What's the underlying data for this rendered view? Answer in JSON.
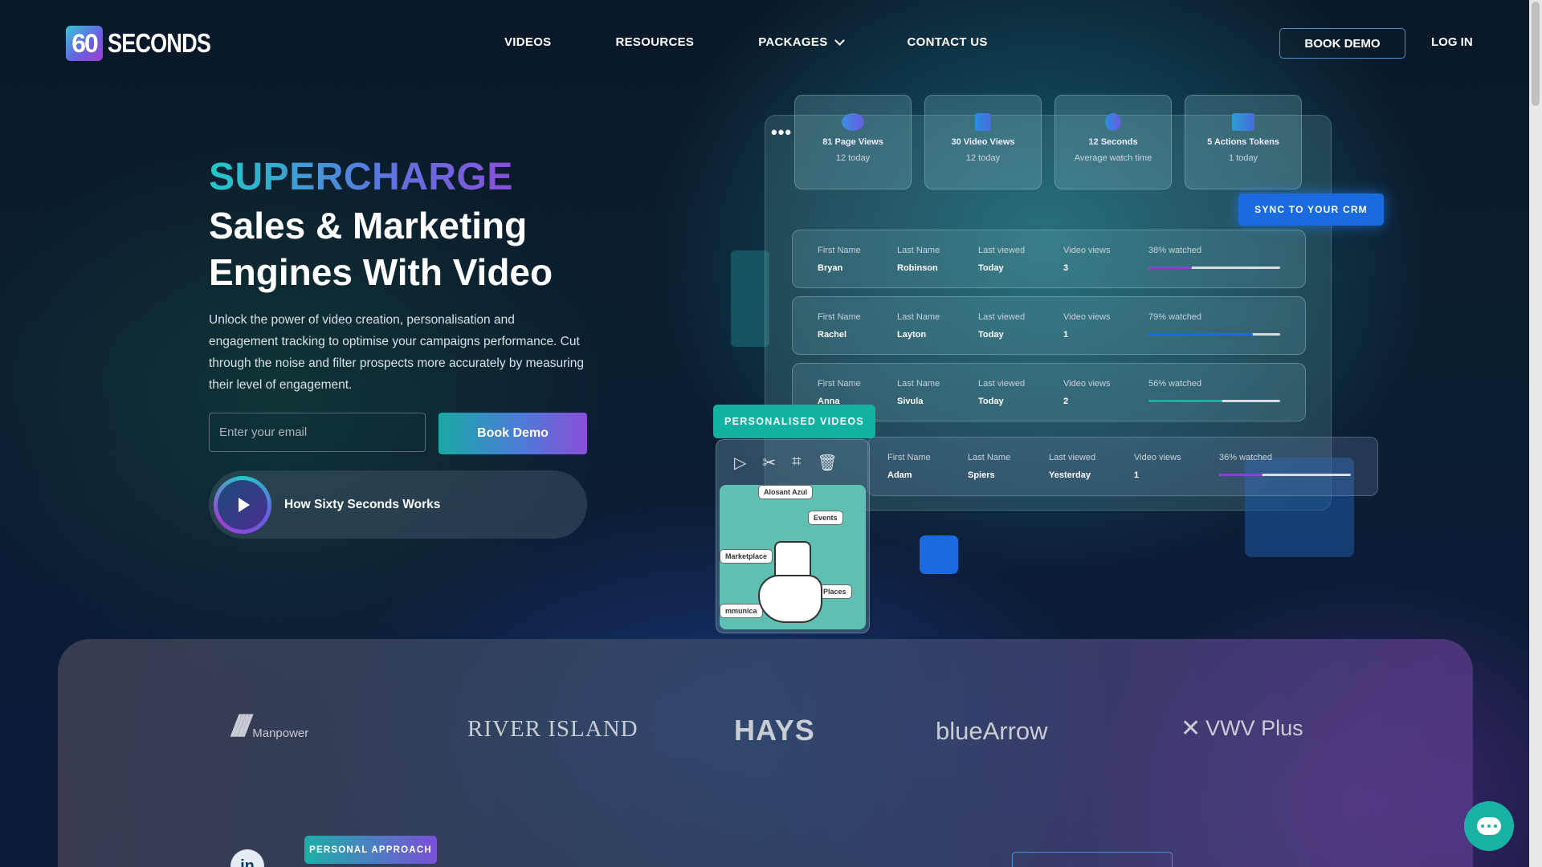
{
  "brand": {
    "logo_number": "60",
    "logo_word": "SECONDS"
  },
  "nav": {
    "items": [
      {
        "label": "VIDEOS"
      },
      {
        "label": "RESOURCES"
      },
      {
        "label": "PACKAGES"
      },
      {
        "label": "CONTACT US"
      }
    ],
    "book_demo": "BOOK DEMO",
    "login": "LOG IN"
  },
  "hero": {
    "kicker": "SUPERCHARGE",
    "title": "Sales & Marketing Engines With Video",
    "copy": "Unlock the power of video creation, personalisation and engagement tracking to optimise your campaigns performance. Cut through the noise and filter prospects more accurately by measuring their level of engagement.",
    "email_placeholder": "Enter your email",
    "cta": "Book Demo",
    "how_label": "How Sixty Seconds Works"
  },
  "stats": [
    {
      "title": "81 Page Views",
      "sub": "12 today",
      "icon": "eye-icon",
      "color": "#6a5be2"
    },
    {
      "title": "30 Video Views",
      "sub": "12 today",
      "icon": "play-icon",
      "color": "#3a7fe0"
    },
    {
      "title": "12 Seconds",
      "sub": "Average watch time",
      "icon": "clock-icon",
      "color": "#4a6ae0"
    },
    {
      "title": "5 Actions Tokens",
      "sub": "1 today",
      "icon": "flag-icon",
      "color": "#2a9fd0"
    }
  ],
  "sync_label": "SYNC TO YOUR CRM",
  "table_labels": {
    "first": "First Name",
    "last": "Last Name",
    "viewed": "Last viewed",
    "views": "Video views"
  },
  "rows": [
    {
      "first": "Bryan",
      "last": "Robinson",
      "viewed": "Today",
      "views": "3",
      "watched": "38% watched",
      "pct": 0.33,
      "color": "#8a3fd8"
    },
    {
      "first": "Rachel",
      "last": "Layton",
      "viewed": "Today",
      "views": "1",
      "watched": "79% watched",
      "pct": 0.79,
      "color": "#1b6be0"
    },
    {
      "first": "Anna",
      "last": "Sivula",
      "viewed": "Today",
      "views": "2",
      "watched": "56% watched",
      "pct": 0.56,
      "color": "#15b0a0"
    },
    {
      "first": "Adam",
      "last": "Spiers",
      "viewed": "Yesterday",
      "views": "1",
      "watched": "36% watched",
      "pct": 0.33,
      "color": "#8a3fd8"
    }
  ],
  "personalised_label": "PERSONALISED VIDEOS",
  "video_bubbles": [
    "Alosant Azul",
    "Events",
    "Marketplace",
    "Places",
    "mmunica"
  ],
  "logos": {
    "manpower": "Manpower",
    "river_island": "RIVER ISLAND",
    "hays": "HAYS",
    "bluearrow": "blueArrow",
    "vwv": "VWV Plus"
  },
  "linkedin": "in",
  "personal_approach": "PERSONAL APPROACH"
}
